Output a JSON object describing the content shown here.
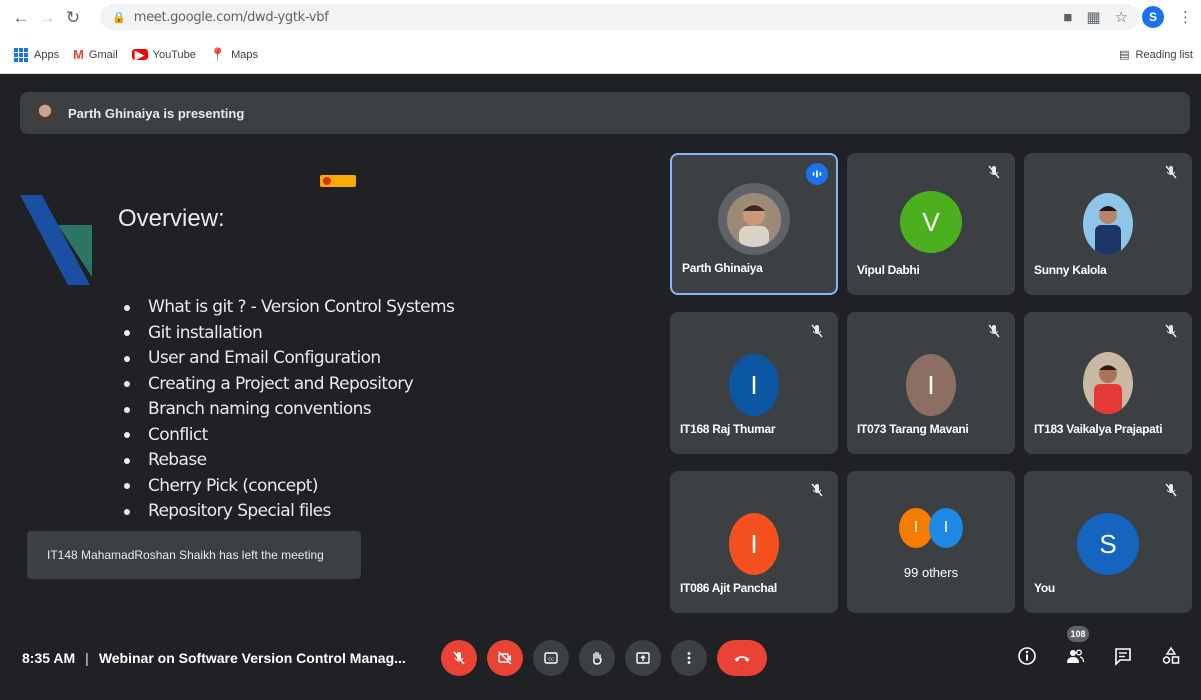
{
  "browser": {
    "url": "meet.google.com/dwd-ygtk-vbf",
    "profile_initial": "S",
    "bookmarks": [
      {
        "label": "Apps",
        "icon": "apps-grid-icon"
      },
      {
        "label": "Gmail",
        "icon": "gmail-icon"
      },
      {
        "label": "YouTube",
        "icon": "youtube-icon"
      },
      {
        "label": "Maps",
        "icon": "maps-icon"
      }
    ],
    "reading_list": "Reading list"
  },
  "presenting": {
    "text": "Parth Ghinaiya is presenting"
  },
  "slide": {
    "title": "Overview:",
    "bullets": [
      "What is git ? - Version Control Systems",
      "Git installation",
      "User and Email Configuration",
      "Creating a Project and Repository",
      "Branch naming conventions",
      "Conflict",
      "Rebase",
      "Cherry Pick (concept)",
      "Repository Special files"
    ]
  },
  "toast": {
    "text": "IT148 MahamadRoshan Shaikh has left the meeting"
  },
  "participants": [
    {
      "name": "Parth Ghinaiya",
      "type": "photo",
      "speaking": true
    },
    {
      "name": "Vipul Dabhi",
      "type": "initial",
      "initial": "V",
      "color": "#4caf1e",
      "muted": true
    },
    {
      "name": "Sunny Kalola",
      "type": "photo",
      "muted": true
    },
    {
      "name": "IT168 Raj Thumar",
      "type": "initial",
      "initial": "I",
      "color": "#0b57a4",
      "muted": true
    },
    {
      "name": "IT073 Tarang Mavani",
      "type": "initial",
      "initial": "I",
      "color": "#8d6e63",
      "muted": true
    },
    {
      "name": "IT183 Vaikalya Prajapati",
      "type": "photo",
      "muted": true
    },
    {
      "name": "IT086 Ajit Panchal",
      "type": "initial",
      "initial": "I",
      "color": "#f4511e",
      "muted": true
    },
    {
      "name": "99 others",
      "type": "others",
      "initials": [
        "I",
        "I"
      ],
      "colors": [
        "#f57c00",
        "#1e88e5"
      ]
    },
    {
      "name": "You",
      "type": "initial",
      "initial": "S",
      "color": "#1565c0",
      "muted": true
    }
  ],
  "bottom": {
    "time": "8:35 AM",
    "separator": "|",
    "meeting_title": "Webinar on Software Version Control Manag...",
    "participant_count": "108"
  }
}
